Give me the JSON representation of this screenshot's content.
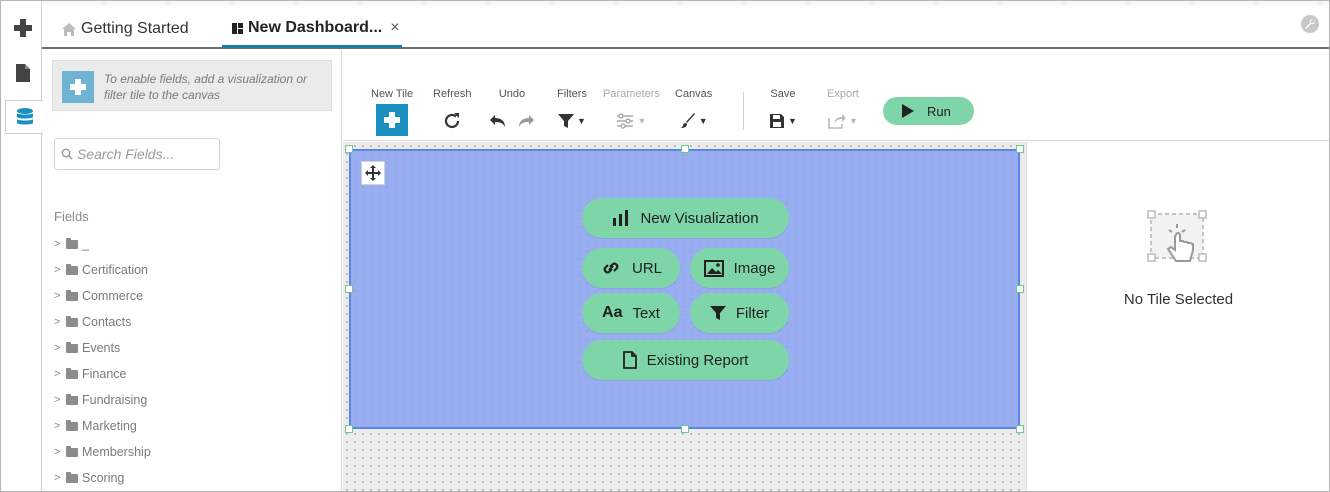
{
  "tabs": [
    {
      "label": "Getting Started"
    },
    {
      "label": "New Dashboard..."
    }
  ],
  "tab_close_glyph": "×",
  "sidebar": {
    "hint": "To enable fields, add a visualization or filter tile to the canvas",
    "search_placeholder": "Search Fields...",
    "fields_title": "Fields",
    "fields": [
      "_",
      "Certification",
      "Commerce",
      "Contacts",
      "Events",
      "Finance",
      "Fundraising",
      "Marketing",
      "Membership",
      "Scoring"
    ]
  },
  "toolbar": {
    "new_tile": "New Tile",
    "refresh": "Refresh",
    "undo": "Undo",
    "filters": "Filters",
    "parameters": "Parameters",
    "canvas": "Canvas",
    "save": "Save",
    "export": "Export",
    "run": "Run"
  },
  "tile_menu": {
    "new_visualization": "New Visualization",
    "url": "URL",
    "image": "Image",
    "text": "Text",
    "text_icon": "Aa",
    "filter": "Filter",
    "existing_report": "Existing Report"
  },
  "right_panel": {
    "no_tile": "No Tile Selected"
  },
  "colors": {
    "accent": "#1a7ea3",
    "run_green": "#7ed6a8",
    "tile_blue": "#99aef0",
    "new_tile_blue": "#1a8fc0"
  },
  "icons": {
    "rail": [
      "plus-icon",
      "document-icon",
      "database-icon"
    ],
    "settings": "wrench-icon"
  }
}
